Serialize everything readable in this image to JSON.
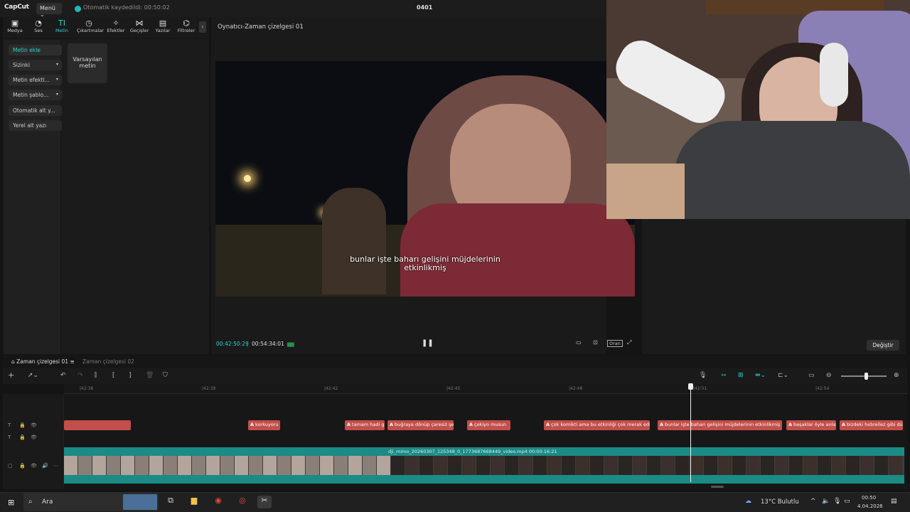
{
  "app": {
    "logo": "CapCut",
    "menu_label": "Menü",
    "autosave": "Otomatik kaydedildi: 00:50:02",
    "project_title": "0401"
  },
  "tools": [
    {
      "label": "Medya",
      "icon": "media-icon"
    },
    {
      "label": "Ses",
      "icon": "audio-icon"
    },
    {
      "label": "Metin",
      "icon": "text-icon"
    },
    {
      "label": "Çıkartmalar",
      "icon": "sticker-icon"
    },
    {
      "label": "Efektler",
      "icon": "effects-icon"
    },
    {
      "label": "Geçişler",
      "icon": "transitions-icon"
    },
    {
      "label": "Yazılar",
      "icon": "captions-icon"
    },
    {
      "label": "Filtreler",
      "icon": "filters-icon"
    }
  ],
  "sidenav": [
    {
      "label": "Metin ekle"
    },
    {
      "label": "Sizinki"
    },
    {
      "label": "Metin efektl..."
    },
    {
      "label": "Metin şablo..."
    },
    {
      "label": "Otomatik alt y..."
    },
    {
      "label": "Yerel alt yazı"
    }
  ],
  "preset": {
    "line1": "Varsayılan",
    "line2": "metin"
  },
  "player": {
    "title": "Oynatıcı-Zaman çizelgesi 01",
    "subtitle_line1": "bunlar işte baharı gelişini müjdelerinin",
    "subtitle_line2": "etkinlikmiş",
    "current_time": "00:42:50:29",
    "total_time": "00:54:34:01",
    "ratio_label": "Oran"
  },
  "right_panel": {
    "apply_button": "Değiştir"
  },
  "timeline": {
    "tab_active": "Zaman çizelgesi 01",
    "tab_inactive": "Zaman çizelgesi 02",
    "ruler_ticks": [
      "|42:36",
      "|42:39",
      "|42:42",
      "|42:45",
      "|42:48",
      "|42:51",
      "|42:54"
    ],
    "text_clips": [
      {
        "tag": "",
        "text": ""
      },
      {
        "tag": "A",
        "text": "korkuyoru"
      },
      {
        "tag": "A",
        "text": "tamam hadi g"
      },
      {
        "tag": "A",
        "text": "buğraya dönüp çaresiz şe"
      },
      {
        "tag": "A",
        "text": "çekiyo musun"
      },
      {
        "tag": "A",
        "text": "çok komikti ama bu etkinliği çok merak ediy"
      },
      {
        "tag": "A",
        "text": "bunlar işte baharı gelişini müjdelerinin etkinlikmiş"
      },
      {
        "tag": "A",
        "text": "başaklar öyle anlat"
      },
      {
        "tag": "A",
        "text": "bizdeki hıdırellez gibi dür"
      }
    ],
    "video_clip_label": "dji_mimo_20260307_125348_0_1773687668449_video.mp4   00:00:16:21"
  },
  "taskbar": {
    "search_label": "Ara",
    "weather": "13°C  Bulutlu",
    "time": "00:50",
    "date": "4.04.2026"
  },
  "colors": {
    "accent": "#2ad3d0",
    "text_clip": "#c24f4a",
    "video_clip": "#1b8b86"
  }
}
